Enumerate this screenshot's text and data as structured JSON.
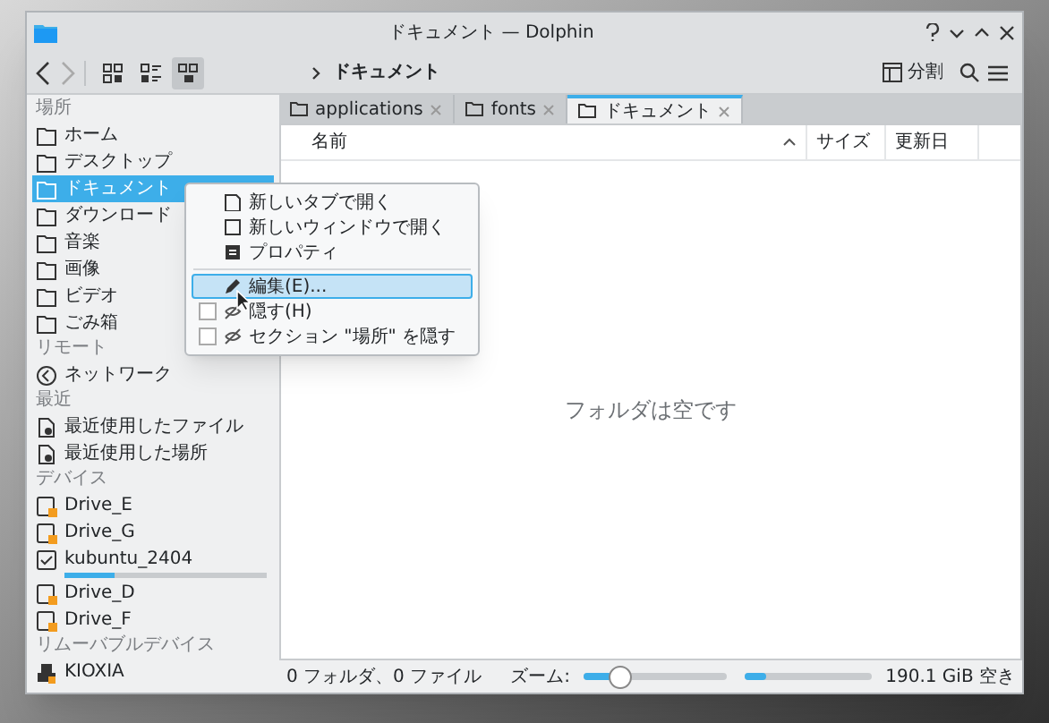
{
  "window": {
    "title": "ドキュメント — Dolphin"
  },
  "toolbar": {
    "navigation": [
      {
        "kind": "back",
        "disabled": false
      },
      {
        "kind": "forward",
        "disabled": true
      }
    ],
    "view_modes": [
      {
        "selected": false
      },
      {
        "selected": false
      },
      {
        "selected": true
      }
    ],
    "breadcrumb": "ドキュメント",
    "split_label": "分割"
  },
  "sidebar": {
    "sections": [
      {
        "title": "場所",
        "items": [
          {
            "label": "ホーム",
            "kind": "place",
            "selected": false
          },
          {
            "label": "デスクトップ",
            "kind": "place",
            "selected": false
          },
          {
            "label": "ドキュメント",
            "kind": "place",
            "selected": true
          },
          {
            "label": "ダウンロード",
            "kind": "place",
            "selected": false
          },
          {
            "label": "音楽",
            "kind": "place",
            "selected": false
          },
          {
            "label": "画像",
            "kind": "place",
            "selected": false
          },
          {
            "label": "ビデオ",
            "kind": "place",
            "selected": false
          },
          {
            "label": "ごみ箱",
            "kind": "place",
            "selected": false
          }
        ]
      },
      {
        "title": "リモート",
        "items": [
          {
            "label": "ネットワーク",
            "kind": "network",
            "selected": false
          }
        ]
      },
      {
        "title": "最近",
        "items": [
          {
            "label": "最近使用したファイル",
            "kind": "recent",
            "selected": false
          },
          {
            "label": "最近使用した場所",
            "kind": "recent",
            "selected": false
          }
        ]
      },
      {
        "title": "デバイス",
        "items": [
          {
            "label": "Drive_E",
            "kind": "drive",
            "selected": false
          },
          {
            "label": "Drive_G",
            "kind": "drive",
            "selected": false
          },
          {
            "label": "kubuntu_2404",
            "kind": "mounted",
            "selected": false,
            "level": 0.25
          },
          {
            "label": "Drive_D",
            "kind": "drive",
            "selected": false
          },
          {
            "label": "Drive_F",
            "kind": "drive",
            "selected": false
          }
        ]
      },
      {
        "title": "リムーバブルデバイス",
        "items": [
          {
            "label": "KIOXIA",
            "kind": "removable",
            "selected": false
          }
        ]
      }
    ]
  },
  "context_menu": {
    "items": [
      {
        "label": "新しいタブで開く",
        "kind": "action",
        "selected": false
      },
      {
        "label": "新しいウィンドウで開く",
        "kind": "action",
        "selected": false
      },
      {
        "label": "プロパティ",
        "kind": "action",
        "selected": false
      },
      {
        "label": "編集(E)...",
        "kind": "action",
        "selected": true
      },
      {
        "label": "隠す(H)",
        "kind": "checkbox",
        "checked": false,
        "selected": false
      },
      {
        "label": "セクション \"場所\" を隠す",
        "kind": "checkbox",
        "checked": false,
        "selected": false
      }
    ]
  },
  "tabs": [
    {
      "label": "applications",
      "selected": false
    },
    {
      "label": "fonts",
      "selected": false
    },
    {
      "label": "ドキュメント",
      "selected": true
    }
  ],
  "table": {
    "columns": [
      "名前",
      "サイズ",
      "更新日"
    ],
    "empty_message": "フォルダは空です"
  },
  "status_bar": {
    "summary": "0 フォルダ、0 ファイル",
    "zoom_label": "ズーム:",
    "zoom": {
      "level": 0.2
    },
    "space": {
      "level": 0.18
    },
    "free_space": "190.1 GiB 空き"
  }
}
